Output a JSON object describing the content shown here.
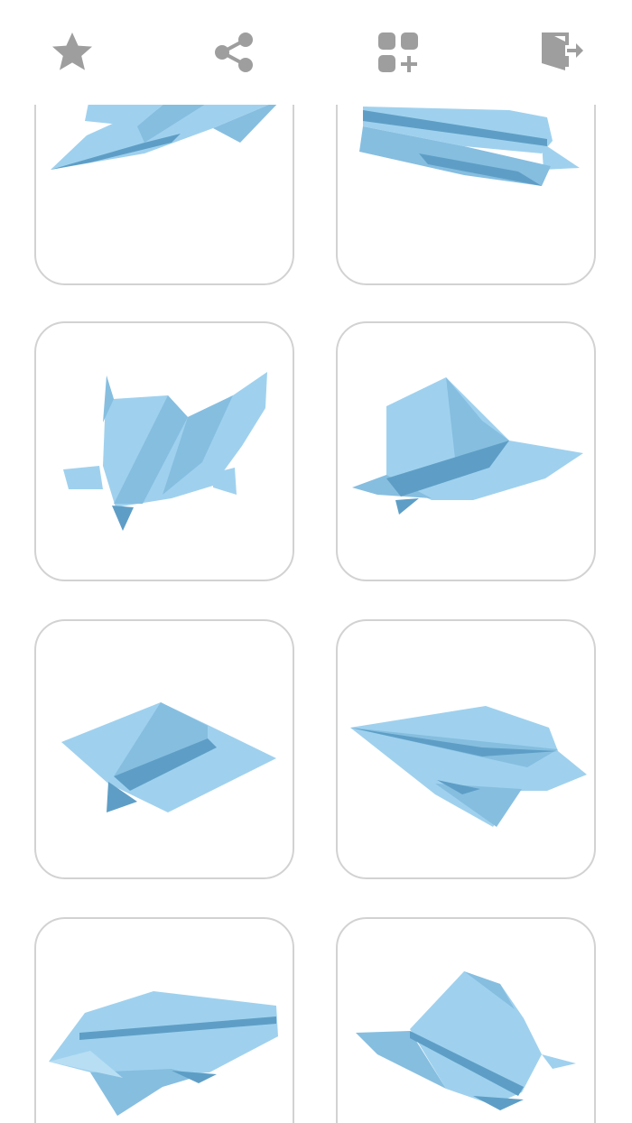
{
  "toolbar": {
    "items": [
      {
        "name": "favorites",
        "icon": "star-icon"
      },
      {
        "name": "share",
        "icon": "share-icon"
      },
      {
        "name": "more-apps",
        "icon": "apps-add-icon"
      },
      {
        "name": "exit",
        "icon": "exit-icon"
      }
    ],
    "icon_color": "#9e9e9e"
  },
  "grid": {
    "items": [
      {
        "model": "plane-1"
      },
      {
        "model": "plane-2"
      },
      {
        "model": "plane-3"
      },
      {
        "model": "plane-4"
      },
      {
        "model": "plane-5"
      },
      {
        "model": "plane-6"
      },
      {
        "model": "plane-7"
      },
      {
        "model": "plane-8"
      }
    ]
  },
  "colors": {
    "paper_light": "#9fd1ee",
    "paper_mid": "#86bee0",
    "paper_dark": "#5e9ec6",
    "card_border": "#d2d2d2",
    "background": "#ffffff"
  }
}
